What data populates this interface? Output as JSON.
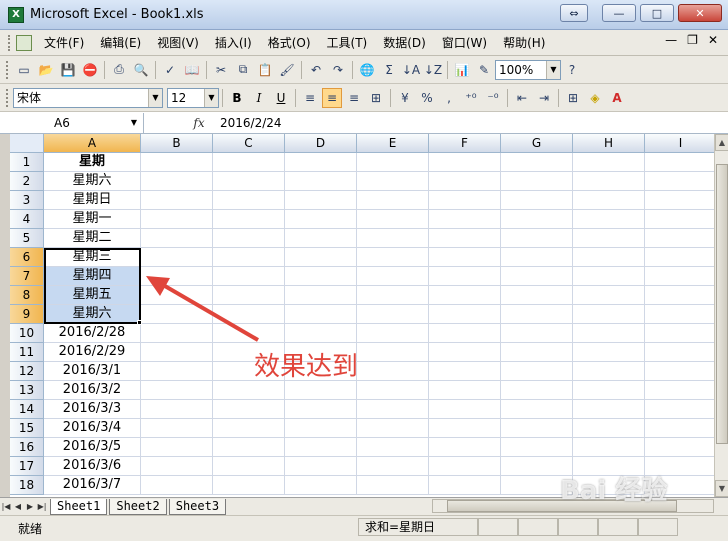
{
  "window": {
    "title": "Microsoft Excel - Book1.xls",
    "app_icon": "X"
  },
  "menu": [
    "文件(F)",
    "编辑(E)",
    "视图(V)",
    "插入(I)",
    "格式(O)",
    "工具(T)",
    "数据(D)",
    "窗口(W)",
    "帮助(H)"
  ],
  "toolbar": {
    "zoom": "100%"
  },
  "format_toolbar": {
    "font": "宋体",
    "size": "12",
    "bold": "B",
    "italic": "I",
    "underline": "U",
    "percent": "%",
    "comma": ","
  },
  "formula_bar": {
    "name_box": "A6",
    "fx": "fx",
    "value": "2016/2/24"
  },
  "columns": [
    "A",
    "B",
    "C",
    "D",
    "E",
    "F",
    "G",
    "H",
    "I"
  ],
  "rows": [
    "1",
    "2",
    "3",
    "4",
    "5",
    "6",
    "7",
    "8",
    "9",
    "10",
    "11",
    "12",
    "13",
    "14",
    "15",
    "16",
    "17",
    "18"
  ],
  "col_a": [
    "星期",
    "星期六",
    "星期日",
    "星期一",
    "星期二",
    "星期三",
    "星期四",
    "星期五",
    "星期六",
    "2016/2/28",
    "2016/2/29",
    "2016/3/1",
    "2016/3/2",
    "2016/3/3",
    "2016/3/4",
    "2016/3/5",
    "2016/3/6",
    "2016/3/7"
  ],
  "sheets": [
    "Sheet1",
    "Sheet2",
    "Sheet3"
  ],
  "status": {
    "ready": "就绪",
    "sum": "求和=星期日"
  },
  "annotation": "效果达到",
  "watermark": "Bai 经验",
  "colors": {
    "accent": "#e0453b",
    "selection": "#c6d9f1",
    "header_selected": "#f1b54f"
  }
}
